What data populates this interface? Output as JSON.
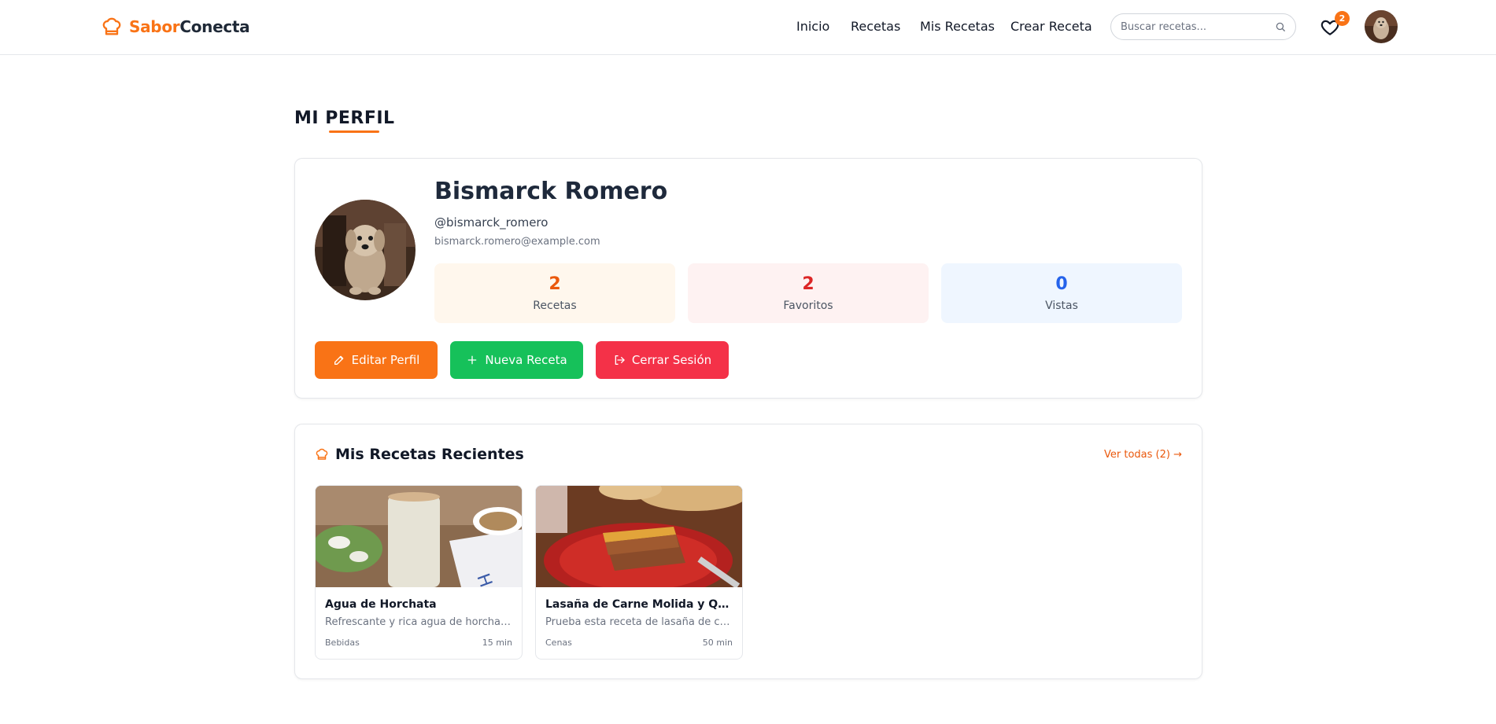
{
  "brand": {
    "part1": "Sabor",
    "part2": "Conecta"
  },
  "nav": [
    "Inicio",
    "Recetas",
    "Mis Recetas",
    "Crear Receta"
  ],
  "search": {
    "placeholder": "Buscar recetas..."
  },
  "favorites_count": "2",
  "page_title": "MI PERFIL",
  "profile": {
    "name": "Bismarck Romero",
    "username": "@bismarck_romero",
    "email": "bismarck.romero@example.com"
  },
  "stats": [
    {
      "value": "2",
      "label": "Recetas",
      "color": "#ea580c",
      "bg": "#fff7ed"
    },
    {
      "value": "2",
      "label": "Favoritos",
      "color": "#dc2626",
      "bg": "#fef2f2"
    },
    {
      "value": "0",
      "label": "Vistas",
      "color": "#2563eb",
      "bg": "#eff6ff"
    }
  ],
  "buttons": {
    "edit": "Editar Perfil",
    "new": "Nueva Receta",
    "logout": "Cerrar Sesión"
  },
  "colors": {
    "accent": "#f97316",
    "green": "#16c15a",
    "red": "#f43148"
  },
  "recent": {
    "title": "Mis Recetas Recientes",
    "see_all": "Ver todas (2) →",
    "items": [
      {
        "title": "Agua de Horchata",
        "desc": "Refrescante y rica agua de horchata casera",
        "category": "Bebidas",
        "time": "15 min"
      },
      {
        "title": "Lasaña de Carne Molida y Queso",
        "desc": "Prueba esta receta de lasaña de carne molida",
        "category": "Cenas",
        "time": "50 min"
      }
    ]
  }
}
